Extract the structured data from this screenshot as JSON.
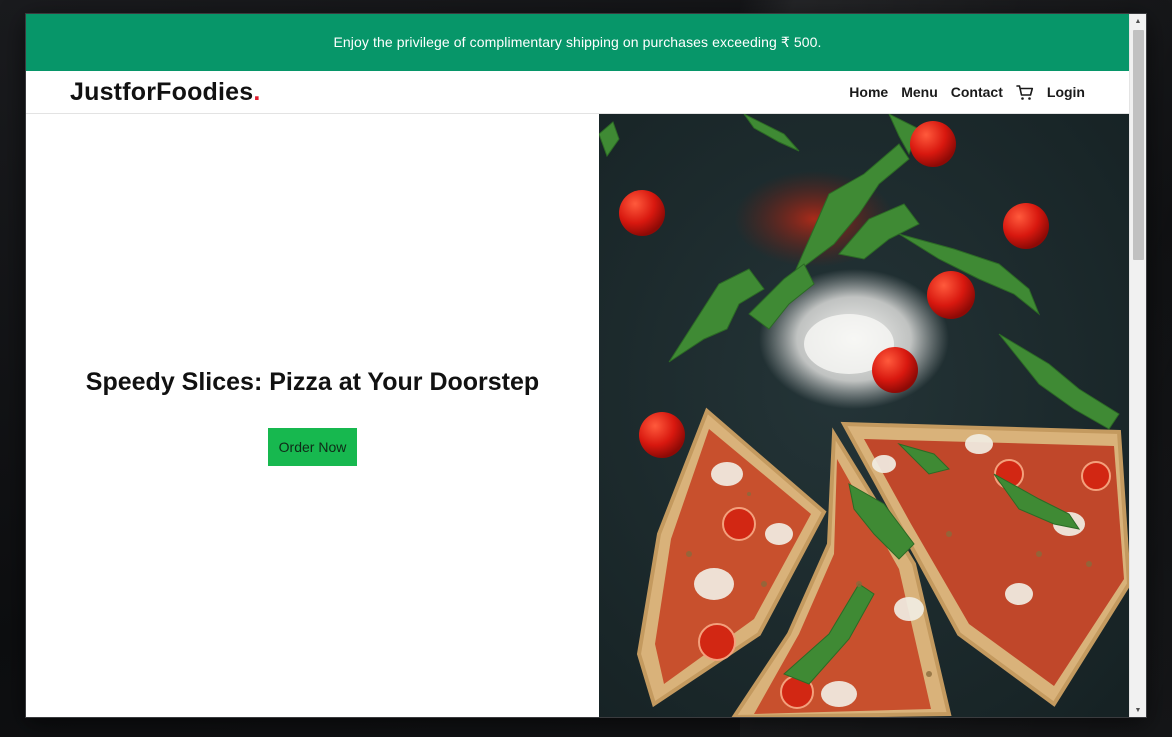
{
  "promo": {
    "text": "Enjoy the privilege of complimentary shipping on purchases exceeding ₹ 500."
  },
  "navbar": {
    "brand": "JustforFoodies",
    "brand_dot": ".",
    "links": [
      {
        "label": "Home"
      },
      {
        "label": "Menu"
      },
      {
        "label": "Contact"
      }
    ],
    "cart_icon": "shopping-cart-icon",
    "login_label": "Login"
  },
  "hero": {
    "title": "Speedy Slices: Pizza at Your Doorstep",
    "cta_label": "Order Now",
    "image": "pizza-slices-with-tomatoes-and-arugula-photo"
  },
  "colors": {
    "promo_bg": "#079669",
    "cta_bg": "#17b84f",
    "brand_dot": "#e11d2e"
  }
}
